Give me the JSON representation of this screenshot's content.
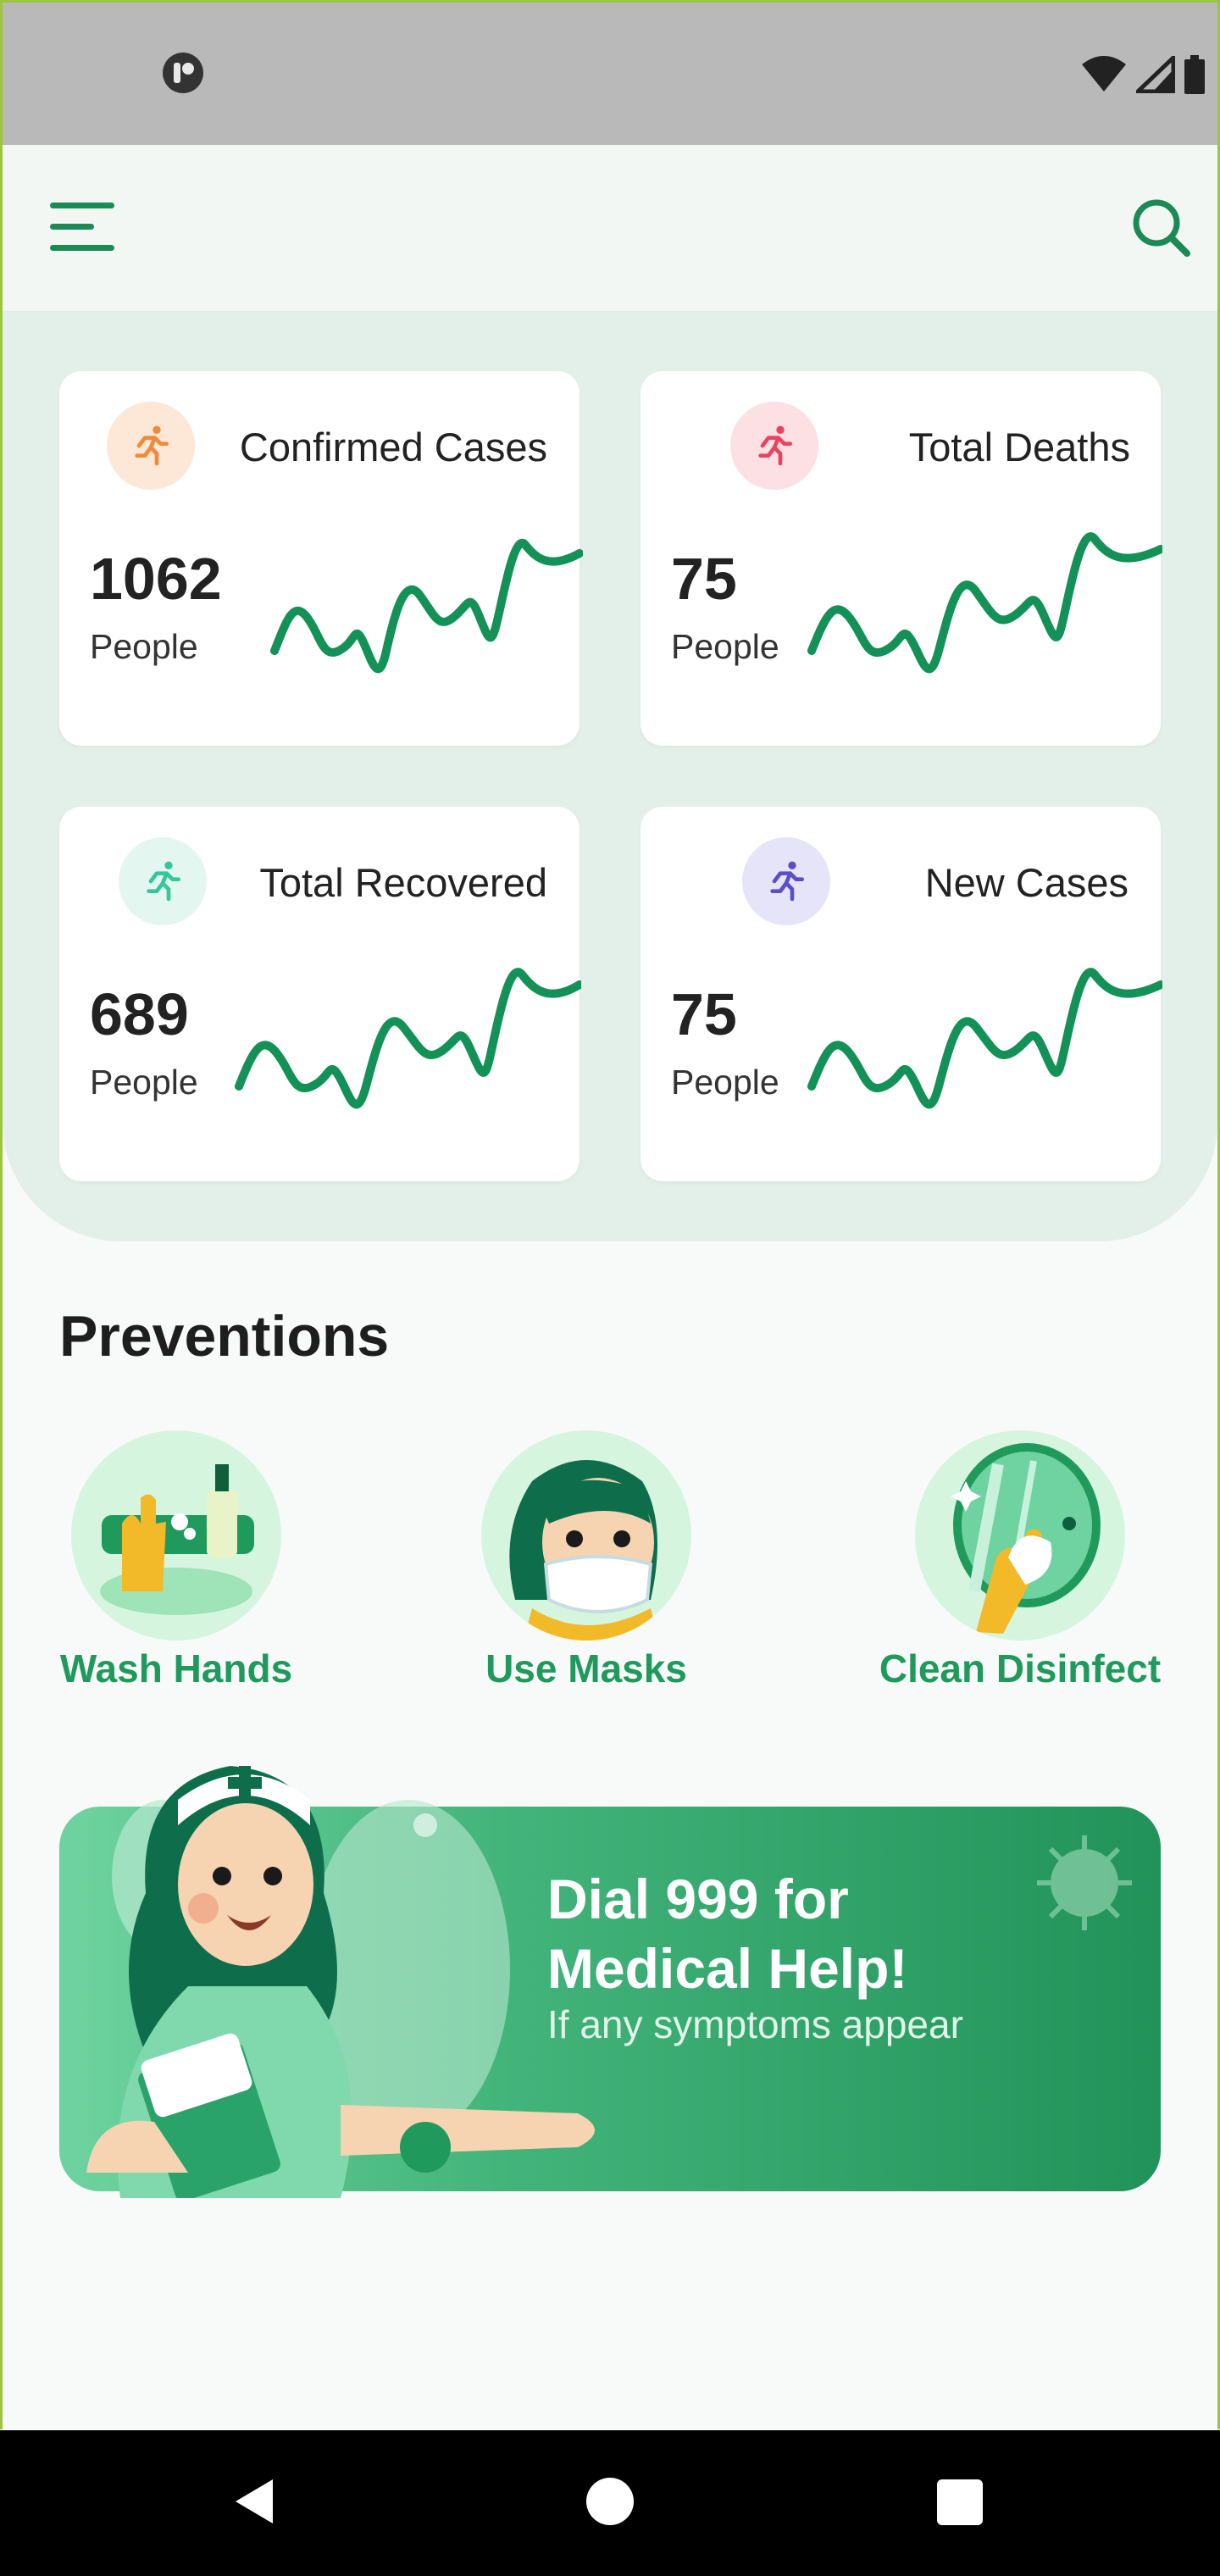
{
  "header": {
    "menu_icon": "hamburger-menu-icon",
    "search_icon": "search-icon"
  },
  "stats": [
    {
      "title": "Confirmed Cases",
      "value": "1062",
      "unit": "People",
      "icon": "running-person-icon",
      "icon_color": "#f08a3a",
      "icon_bg": "#fde7d6"
    },
    {
      "title": "Total Deaths",
      "value": "75",
      "unit": "People",
      "icon": "running-person-icon",
      "icon_color": "#e9445e",
      "icon_bg": "#fde0e4"
    },
    {
      "title": "Total Recovered",
      "value": "689",
      "unit": "People",
      "icon": "running-person-icon",
      "icon_color": "#35c79a",
      "icon_bg": "#e3f7f0"
    },
    {
      "title": "New Cases",
      "value": "75",
      "unit": "People",
      "icon": "running-person-icon",
      "icon_color": "#5b4fc9",
      "icon_bg": "#e6e4f8"
    }
  ],
  "preventions": {
    "title": "Preventions",
    "items": [
      {
        "label": "Wash Hands",
        "icon": "wash-hands-illustration"
      },
      {
        "label": "Use Masks",
        "icon": "mask-illustration"
      },
      {
        "label": "Clean Disinfect",
        "icon": "disinfect-illustration"
      }
    ]
  },
  "banner": {
    "title": "Dial 999 for Medical Help!",
    "subtitle": "If any symptoms appear"
  },
  "colors": {
    "accent": "#1f9a5c",
    "spark": "#139156",
    "panel_bg": "#e3f0e9"
  }
}
